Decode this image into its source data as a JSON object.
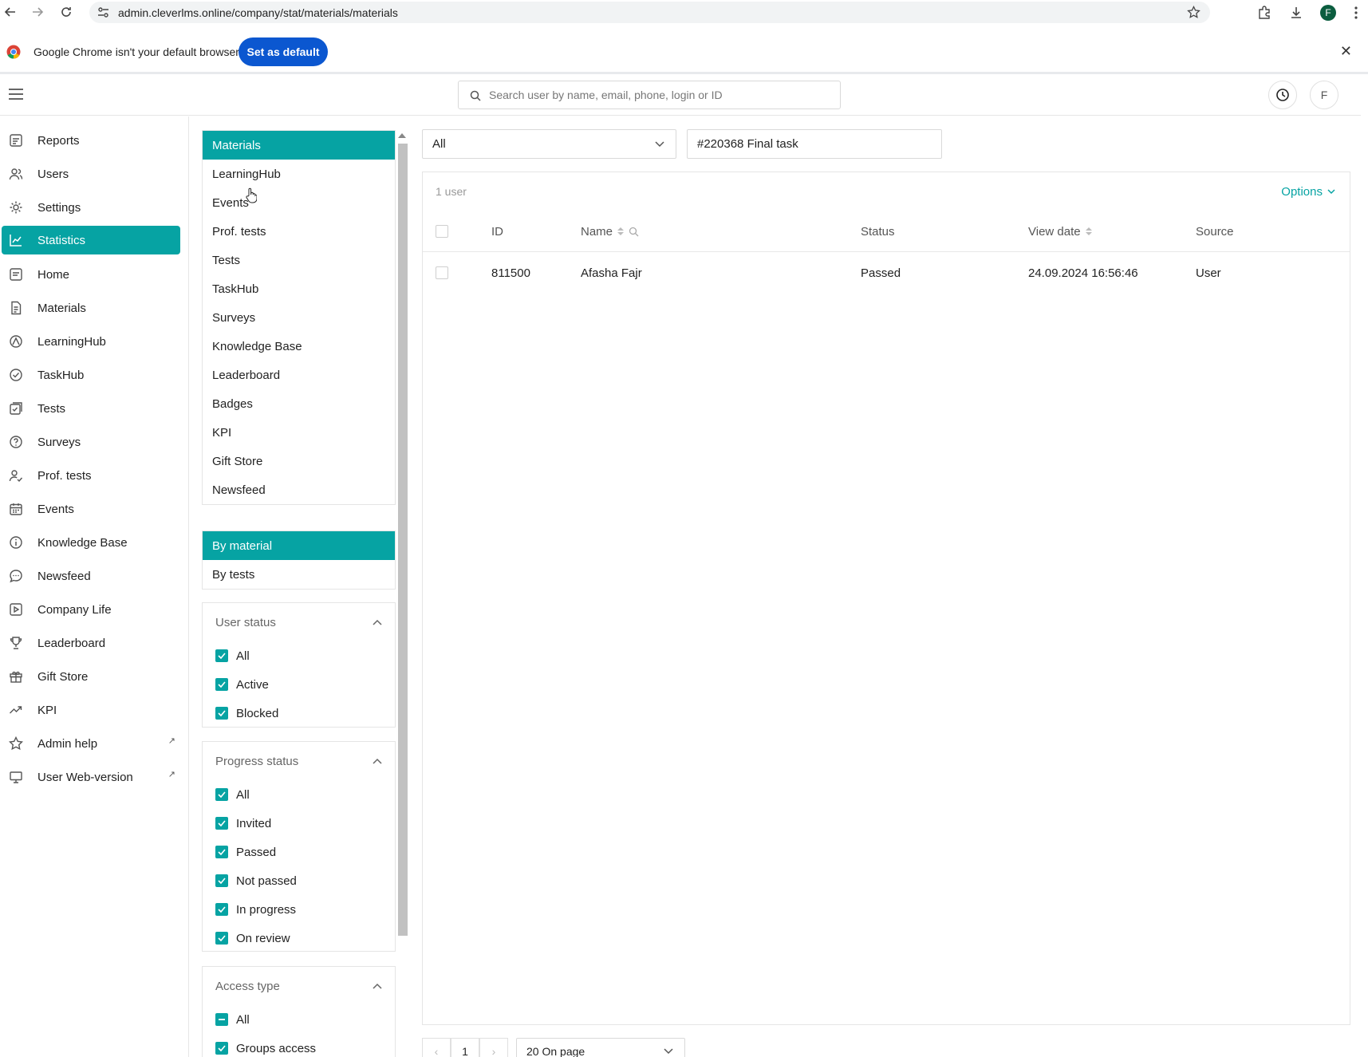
{
  "browser": {
    "url": "admin.cleverlms.online/company/stat/materials/materials",
    "infobar_text": "Google Chrome isn't your default browser",
    "set_default_label": "Set as default",
    "profile_initial": "F"
  },
  "header": {
    "search_placeholder": "Search user by name, email, phone, login or ID",
    "avatar_initial": "F"
  },
  "sidebar": {
    "items": [
      {
        "label": "Reports",
        "icon": "reports-icon"
      },
      {
        "label": "Users",
        "icon": "users-icon"
      },
      {
        "label": "Settings",
        "icon": "gear-icon"
      },
      {
        "label": "Statistics",
        "icon": "chart-icon",
        "active": true
      },
      {
        "label": "Home",
        "icon": "home-icon"
      },
      {
        "label": "Materials",
        "icon": "document-icon"
      },
      {
        "label": "LearningHub",
        "icon": "learninghub-icon"
      },
      {
        "label": "TaskHub",
        "icon": "check-circle-icon"
      },
      {
        "label": "Tests",
        "icon": "tests-icon"
      },
      {
        "label": "Surveys",
        "icon": "question-icon"
      },
      {
        "label": "Prof. tests",
        "icon": "user-check-icon"
      },
      {
        "label": "Events",
        "icon": "calendar-icon"
      },
      {
        "label": "Knowledge Base",
        "icon": "info-icon"
      },
      {
        "label": "Newsfeed",
        "icon": "chat-icon"
      },
      {
        "label": "Company Life",
        "icon": "play-icon"
      },
      {
        "label": "Leaderboard",
        "icon": "trophy-icon"
      },
      {
        "label": "Gift Store",
        "icon": "gift-icon"
      },
      {
        "label": "KPI",
        "icon": "trend-icon"
      },
      {
        "label": "Admin help",
        "icon": "star-icon",
        "external": true
      },
      {
        "label": "User Web-version",
        "icon": "monitor-icon",
        "external": true
      }
    ]
  },
  "stat_nav": {
    "items": [
      "Materials",
      "LearningHub",
      "Events",
      "Prof. tests",
      "Tests",
      "TaskHub",
      "Surveys",
      "Knowledge Base",
      "Leaderboard",
      "Badges",
      "KPI",
      "Gift Store",
      "Newsfeed"
    ]
  },
  "mode_nav": {
    "items": [
      "By material",
      "By tests"
    ]
  },
  "filters": {
    "user_status": {
      "title": "User status",
      "options": [
        "All",
        "Active",
        "Blocked"
      ]
    },
    "progress_status": {
      "title": "Progress status",
      "options": [
        "All",
        "Invited",
        "Passed",
        "Not passed",
        "In progress",
        "On review"
      ]
    },
    "access_type": {
      "title": "Access type",
      "options": [
        "All",
        "Groups access"
      ]
    }
  },
  "main": {
    "type_select": "All",
    "material_select": "#220368 Final task",
    "count": "1 user",
    "options_label": "Options",
    "columns": {
      "id": "ID",
      "name": "Name",
      "status": "Status",
      "view_date": "View date",
      "source": "Source"
    },
    "rows": [
      {
        "id": "811500",
        "name": "Afasha Fajr",
        "status": "Passed",
        "view_date": "24.09.2024 16:56:46",
        "source": "User"
      }
    ],
    "pagination": {
      "page": "1",
      "page_size": "20 On page"
    }
  },
  "colors": {
    "accent": "#06a3a3",
    "chrome_button": "#0b57d0"
  }
}
